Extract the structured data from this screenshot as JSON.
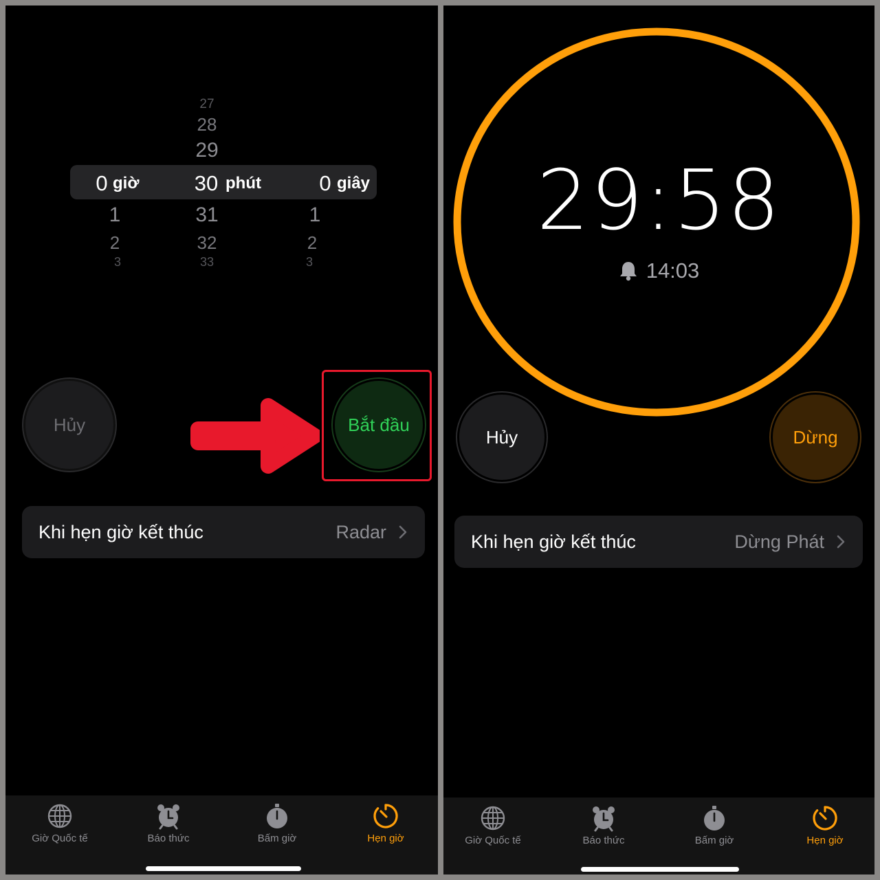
{
  "left": {
    "picker": {
      "hours": {
        "above": [],
        "selected": "0",
        "unit": "giờ",
        "below": [
          "1",
          "2",
          "3"
        ]
      },
      "minutes": {
        "above": [
          "27",
          "28",
          "29"
        ],
        "selected": "30",
        "unit": "phút",
        "below": [
          "31",
          "32",
          "33"
        ]
      },
      "seconds": {
        "above": [],
        "selected": "0",
        "unit": "giây",
        "below": [
          "1",
          "2",
          "3"
        ]
      }
    },
    "cancel_label": "Hủy",
    "start_label": "Bắt đầu",
    "when_ends": {
      "label": "Khi hẹn giờ kết thúc",
      "value": "Radar"
    }
  },
  "right": {
    "remaining": "29:58",
    "end_time": "14:03",
    "cancel_label": "Hủy",
    "pause_label": "Dừng",
    "when_ends": {
      "label": "Khi hẹn giờ kết thúc",
      "value": "Dừng Phát"
    }
  },
  "tabs": [
    {
      "label": "Giờ Quốc tế",
      "icon": "globe-icon",
      "active": false
    },
    {
      "label": "Báo thức",
      "icon": "alarm-clock-icon",
      "active": false
    },
    {
      "label": "Bấm giờ",
      "icon": "stopwatch-icon",
      "active": false
    },
    {
      "label": "Hẹn giờ",
      "icon": "timer-icon",
      "active": true
    }
  ],
  "colors": {
    "accent_orange": "#ff9f0a",
    "start_green": "#30d158",
    "annotation_red": "#e8192c"
  }
}
